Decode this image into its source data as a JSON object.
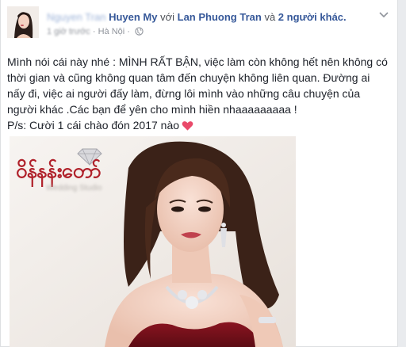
{
  "post": {
    "author_blurred": "Nguyen Tran",
    "author": "Huyen My",
    "with_word": "với",
    "tagged": "Lan Phuong Tran",
    "and_word": "và",
    "others": "2 người khác.",
    "time_blurred": "1 giờ trước",
    "location": "· Hà Nội ·",
    "text_lines": [
      "Mình nói cái này nhé : MÌNH RẤT BẬN, việc làm còn không hết nên không có",
      "thời gian và cũng không quan tâm đến chuyện không liên quan. Đường ai",
      "nấy đi, việc ai người đấy làm, đừng lôi mình vào những câu chuyện của",
      "người khác .Các bạn để yên cho mình hiền nhaaaaaaaaa !",
      "P/s: Cười 1 cái chào đón 2017 nào"
    ],
    "photo_brand": "ဝိန်နန်းတော်",
    "photo_brand_sub": "Wedding Studio"
  },
  "icons": {
    "globe": "globe-icon",
    "chevron": "chevron-down-icon",
    "heart": "heart-icon"
  },
  "colors": {
    "link": "#365899",
    "meta": "#90949c",
    "heart": "#e94a6a",
    "brand": "#b0212a"
  }
}
